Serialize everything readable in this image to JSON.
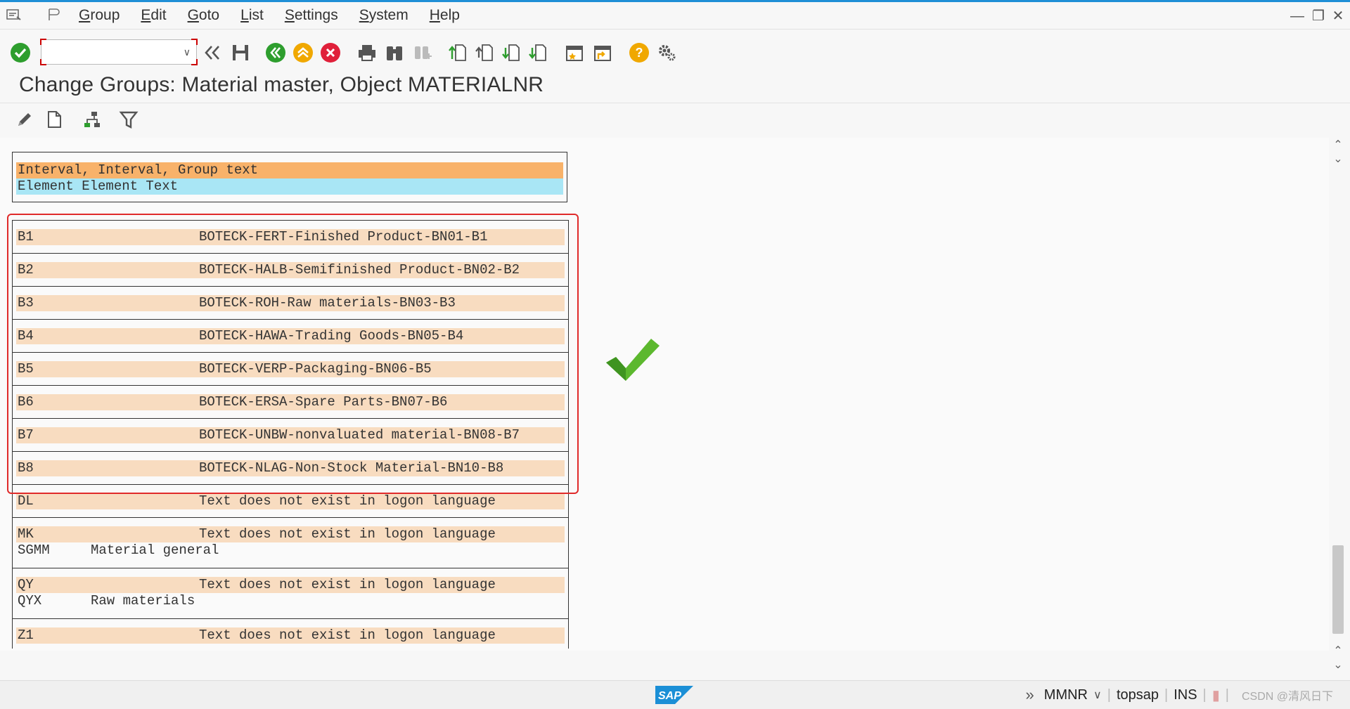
{
  "menu": {
    "items": [
      {
        "label": "Group"
      },
      {
        "label": "Edit"
      },
      {
        "label": "Goto"
      },
      {
        "label": "List"
      },
      {
        "label": "Settings"
      },
      {
        "label": "System"
      },
      {
        "label": "Help"
      }
    ]
  },
  "toolbar": {
    "command_field_value": "",
    "icons": [
      "enter-icon",
      "command-dropdown-icon",
      "collapse-icon",
      "save-icon",
      "back-icon",
      "exit-icon",
      "cancel-icon",
      "print-icon",
      "find-icon",
      "find-next-icon",
      "first-page-icon",
      "previous-page-icon",
      "next-page-icon",
      "last-page-icon",
      "create-session-icon",
      "shortcut-icon",
      "help-icon",
      "customize-layout-icon"
    ]
  },
  "title": "Change Groups: Material master, Object MATERIALNR",
  "app_toolbar": {
    "icons": [
      "edit-pencil-icon",
      "create-document-icon",
      "hierarchy-icon",
      "filter-icon"
    ]
  },
  "list": {
    "header_line1": "Interval, Interval, Group text",
    "header_line2": "Element Element Text",
    "groups": [
      {
        "code": "B1",
        "text": "BOTECK-FERT-Finished Product-BN01-B1"
      },
      {
        "code": "B2",
        "text": "BOTECK-HALB-Semifinished Product-BN02-B2"
      },
      {
        "code": "B3",
        "text": "BOTECK-ROH-Raw materials-BN03-B3"
      },
      {
        "code": "B4",
        "text": "BOTECK-HAWA-Trading Goods-BN05-B4"
      },
      {
        "code": "B5",
        "text": "BOTECK-VERP-Packaging-BN06-B5"
      },
      {
        "code": "B6",
        "text": "BOTECK-ERSA-Spare Parts-BN07-B6"
      },
      {
        "code": "B7",
        "text": "BOTECK-UNBW-nonvaluated material-BN08-B7"
      },
      {
        "code": "B8",
        "text": "BOTECK-NLAG-Non-Stock Material-BN10-B8"
      },
      {
        "code": "DL",
        "text": "Text does not exist in logon language"
      },
      {
        "code": "MK",
        "text": "Text does not exist in logon language",
        "element": {
          "code": "SGMM",
          "text": "Material general"
        }
      },
      {
        "code": "QY",
        "text": "Text does not exist in logon language",
        "element": {
          "code": "QYX",
          "text": "Raw materials"
        }
      },
      {
        "code": "Z1",
        "text": "Text does not exist in logon language"
      }
    ]
  },
  "statusbar": {
    "transaction": "MMNR",
    "system": "topsap",
    "mode": "INS",
    "watermark": "CSDN @清风日下"
  },
  "colors": {
    "accent_line": "#1f8fd6",
    "header_orange": "#f8b26a",
    "header_blue": "#a9e6f5",
    "interval_row": "#f8dcc0",
    "highlight_border": "#e02a2a",
    "check_green": "#2e9e2e"
  }
}
